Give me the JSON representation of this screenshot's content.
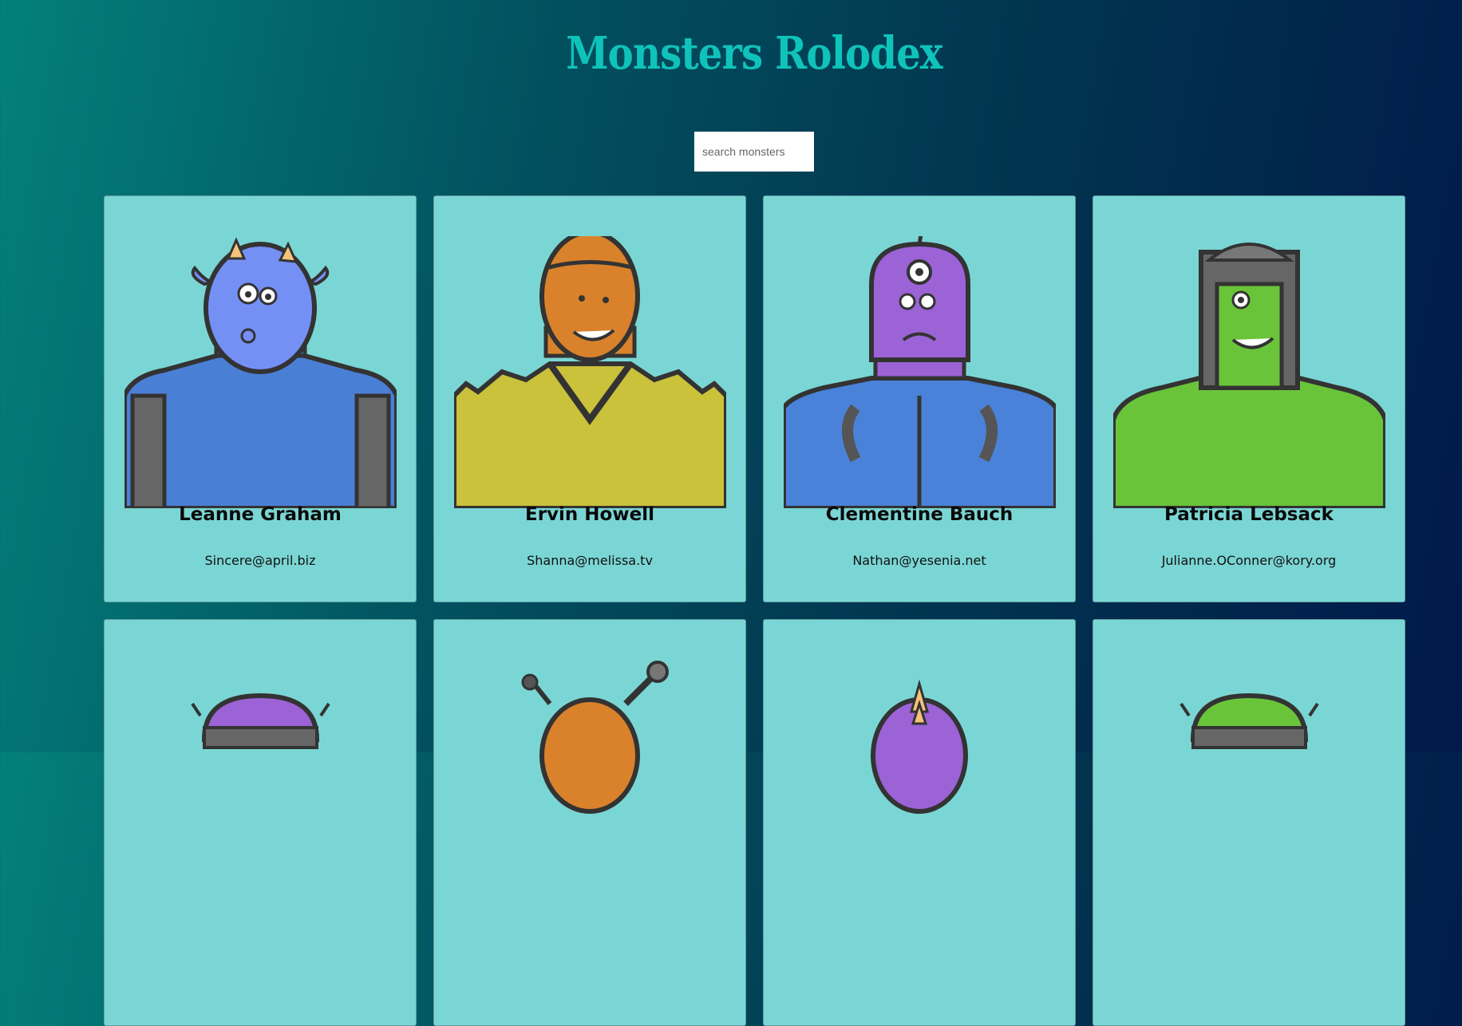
{
  "header": {
    "title": "Monsters Rolodex"
  },
  "search": {
    "placeholder": "search monsters"
  },
  "cards": [
    {
      "name": "Leanne Graham",
      "email": "Sincere@april.biz",
      "icon": "blue-horned-monster",
      "color": "#6f8cf5"
    },
    {
      "name": "Ervin Howell",
      "email": "Shanna@melissa.tv",
      "icon": "orange-spiky-monster",
      "color": "#d9822b"
    },
    {
      "name": "Clementine Bauch",
      "email": "Nathan@yesenia.net",
      "icon": "purple-cyclops-robot-monster",
      "color": "#9b63d6"
    },
    {
      "name": "Patricia Lebsack",
      "email": "Julianne.OConner@kory.org",
      "icon": "green-helmet-monster",
      "color": "#6ac43a"
    },
    {
      "name": "",
      "email": "",
      "icon": "purple-dome-robot-monster",
      "color": "#9b63d6"
    },
    {
      "name": "",
      "email": "",
      "icon": "orange-antenna-monster",
      "color": "#d9822b"
    },
    {
      "name": "",
      "email": "",
      "icon": "purple-horned-monster",
      "color": "#9b63d6"
    },
    {
      "name": "",
      "email": "",
      "icon": "green-dome-robot-monster",
      "color": "#6ac43a"
    }
  ]
}
